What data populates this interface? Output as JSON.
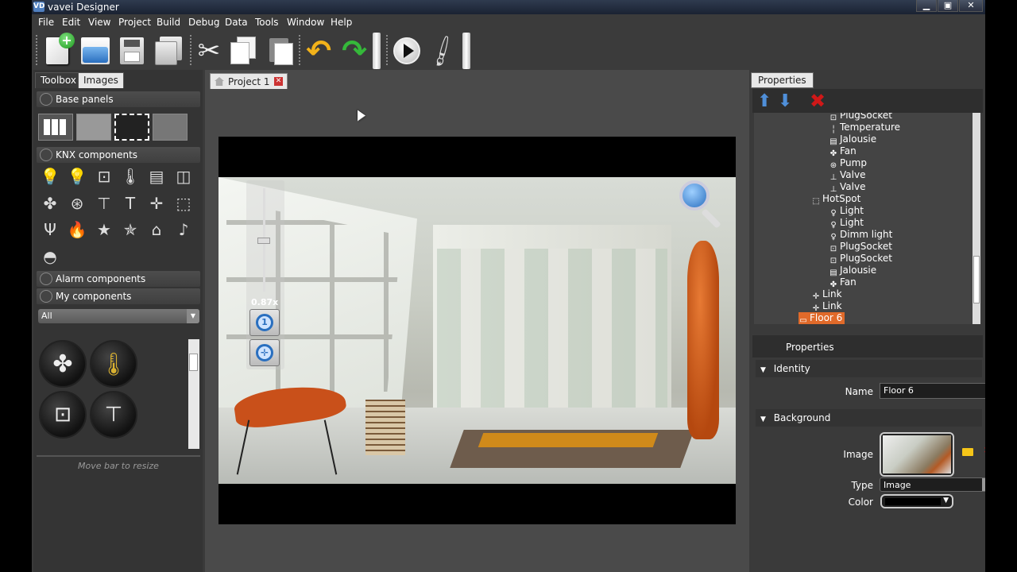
{
  "app": {
    "title": "vavei Designer",
    "icon_text": "VD"
  },
  "window_controls": {
    "minimize": "▁",
    "maximize": "▣",
    "close": "✕"
  },
  "menubar": [
    "File",
    "Edit",
    "View",
    "Project",
    "Build",
    "Debug",
    "Data",
    "Tools",
    "Window",
    "Help"
  ],
  "toolbar": {
    "buttons": [
      "new-project-icon",
      "open-icon",
      "save-icon",
      "save-all-icon",
      "cut-icon",
      "copy-icon",
      "paste-icon",
      "undo-icon",
      "redo-icon",
      "run-icon",
      "deploy-icon"
    ]
  },
  "toolbox": {
    "tabs": [
      "Toolbox",
      "Images"
    ],
    "sections": {
      "base_panels": "Base panels",
      "knx_components": "KNX components",
      "alarm_components": "Alarm components",
      "my_components": "My components"
    },
    "filter": {
      "value": "All"
    },
    "resize_hint": "Move bar to resize"
  },
  "document": {
    "tab_label": "Project 1",
    "zoom_level": "0.87x"
  },
  "properties_panel": {
    "tab_label": "Properties",
    "tree": [
      {
        "label": "PlugSocket",
        "icon": "socket-icon",
        "indent": 2
      },
      {
        "label": "Temperature",
        "icon": "thermometer-icon",
        "indent": 2
      },
      {
        "label": "Jalousie",
        "icon": "jalousie-icon",
        "indent": 2
      },
      {
        "label": "Fan",
        "icon": "fan-icon",
        "indent": 2
      },
      {
        "label": "Pump",
        "icon": "pump-icon",
        "indent": 2
      },
      {
        "label": "Valve",
        "icon": "valve-icon",
        "indent": 2
      },
      {
        "label": "Valve",
        "icon": "valve-icon",
        "indent": 2
      },
      {
        "label": "HotSpot",
        "icon": "hotspot-icon",
        "indent": 1
      },
      {
        "label": "Light",
        "icon": "light-icon",
        "indent": 2
      },
      {
        "label": "Light",
        "icon": "light-icon",
        "indent": 2
      },
      {
        "label": "Dimm light",
        "icon": "light-icon",
        "indent": 2
      },
      {
        "label": "PlugSocket",
        "icon": "socket-icon",
        "indent": 2
      },
      {
        "label": "PlugSocket",
        "icon": "socket-icon",
        "indent": 2
      },
      {
        "label": "Jalousie",
        "icon": "jalousie-icon",
        "indent": 2
      },
      {
        "label": "Fan",
        "icon": "fan-icon",
        "indent": 2
      },
      {
        "label": "Link",
        "icon": "link-icon",
        "indent": 0
      },
      {
        "label": "Link",
        "icon": "link-icon",
        "indent": 0
      },
      {
        "label": "Floor 6",
        "icon": "floor-icon",
        "indent": -1,
        "selected": true
      }
    ],
    "header": "Properties",
    "identity": {
      "group_label": "Identity",
      "name_label": "Name",
      "name_value": "Floor 6"
    },
    "background": {
      "group_label": "Background",
      "image_label": "Image",
      "type_label": "Type",
      "type_value": "Image",
      "color_label": "Color",
      "color_value": "#000000"
    }
  },
  "colors": {
    "accent_selected": "#e06a2a",
    "delete_red": "#d01818",
    "folder_yellow": "#f5c518"
  }
}
